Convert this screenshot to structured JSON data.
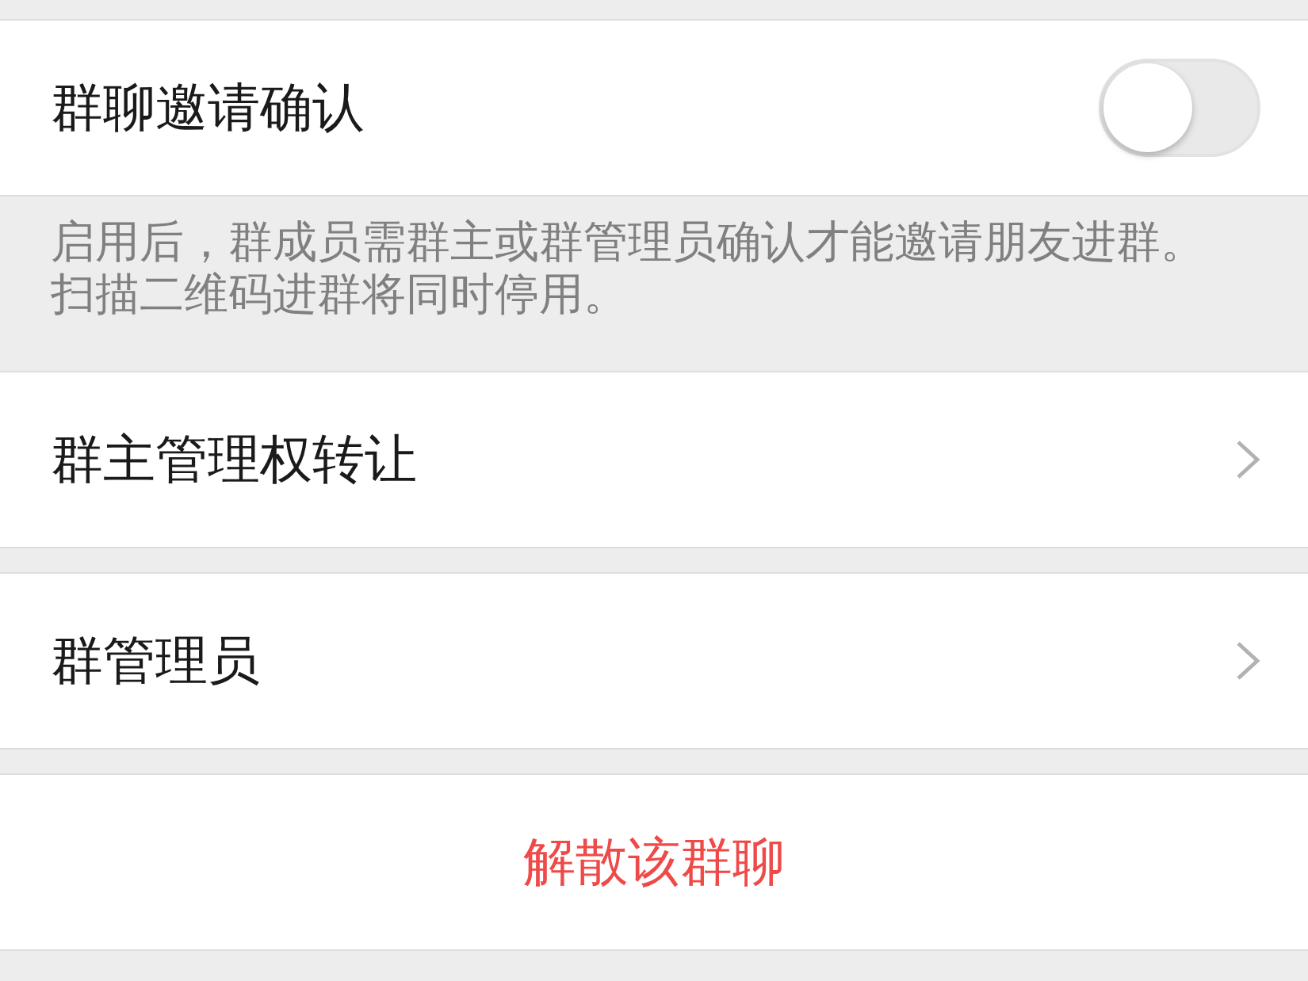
{
  "sections": [
    {
      "items": [
        {
          "kind": "toggle",
          "label": "群聊邀请确认",
          "on": false
        }
      ],
      "footer": "启用后，群成员需群主或群管理员确认才能邀请朋友进群。扫描二维码进群将同时停用。"
    },
    {
      "items": [
        {
          "kind": "link",
          "label": "群主管理权转让"
        }
      ]
    },
    {
      "items": [
        {
          "kind": "link",
          "label": "群管理员"
        }
      ]
    },
    {
      "items": [
        {
          "kind": "danger",
          "label": "解散该群聊"
        }
      ]
    }
  ]
}
